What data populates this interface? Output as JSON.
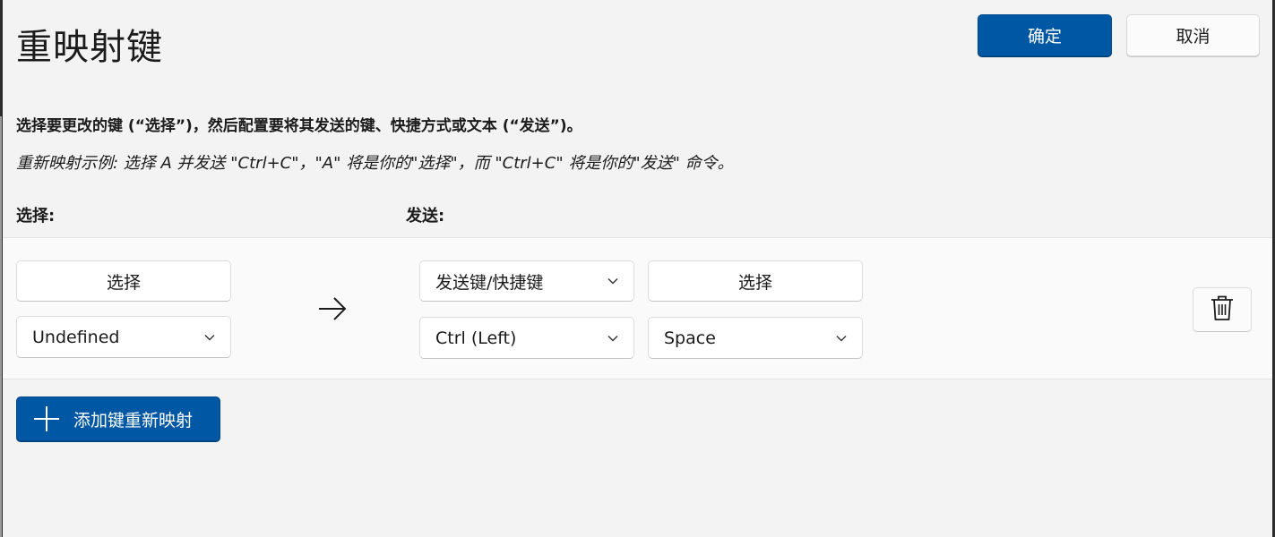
{
  "header": {
    "title": "重映射键",
    "ok_label": "确定",
    "cancel_label": "取消"
  },
  "instructions": {
    "description": "选择要更改的键 (“选择”)，然后配置要将其发送的键、快捷方式或文本 (“发送”)。",
    "example": "重新映射示例: 选择 A 并发送 \"Ctrl+C\"，\"A\" 将是你的\"选择\"，而 \"Ctrl+C\" 将是你的\"发送\" 命令。"
  },
  "columns": {
    "select_label": "选择:",
    "send_label": "发送:"
  },
  "row": {
    "source_select_button": "选择",
    "source_key_value": "Undefined",
    "send_type_value": "发送键/快捷键",
    "send_select_button": "选择",
    "send_modifier_value": "Ctrl (Left)",
    "send_key_value": "Space"
  },
  "add_button_label": "添加键重新映射",
  "icons": {
    "arrow": "arrow-right-icon",
    "chevron": "chevron-down-icon",
    "delete": "trash-icon",
    "plus": "plus-icon"
  },
  "colors": {
    "accent": "#0057a3",
    "background": "#f3f3f3"
  }
}
